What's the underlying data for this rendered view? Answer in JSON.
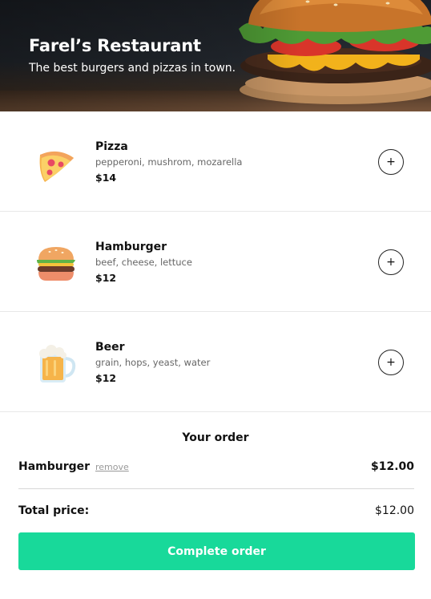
{
  "header": {
    "title": "Farel’s Restaurant",
    "subtitle": "The best burgers and pizzas in town."
  },
  "menu": {
    "items": [
      {
        "name": "Pizza",
        "ingredients": "pepperoni, mushrom, mozarella",
        "price": "$14",
        "icon": "pizza-icon",
        "add_label": "+"
      },
      {
        "name": "Hamburger",
        "ingredients": "beef, cheese, lettuce",
        "price": "$12",
        "icon": "hamburger-icon",
        "add_label": "+"
      },
      {
        "name": "Beer",
        "ingredients": "grain, hops, yeast, water",
        "price": "$12",
        "icon": "beer-icon",
        "add_label": "+"
      }
    ]
  },
  "order": {
    "title": "Your order",
    "lines": [
      {
        "name": "Hamburger",
        "remove_label": "remove",
        "price": "$12.00"
      }
    ],
    "total_label": "Total price:",
    "total_value": "$12.00",
    "complete_label": "Complete order"
  },
  "colors": {
    "accent": "#18d99a",
    "header_bg": "#1e2228"
  }
}
